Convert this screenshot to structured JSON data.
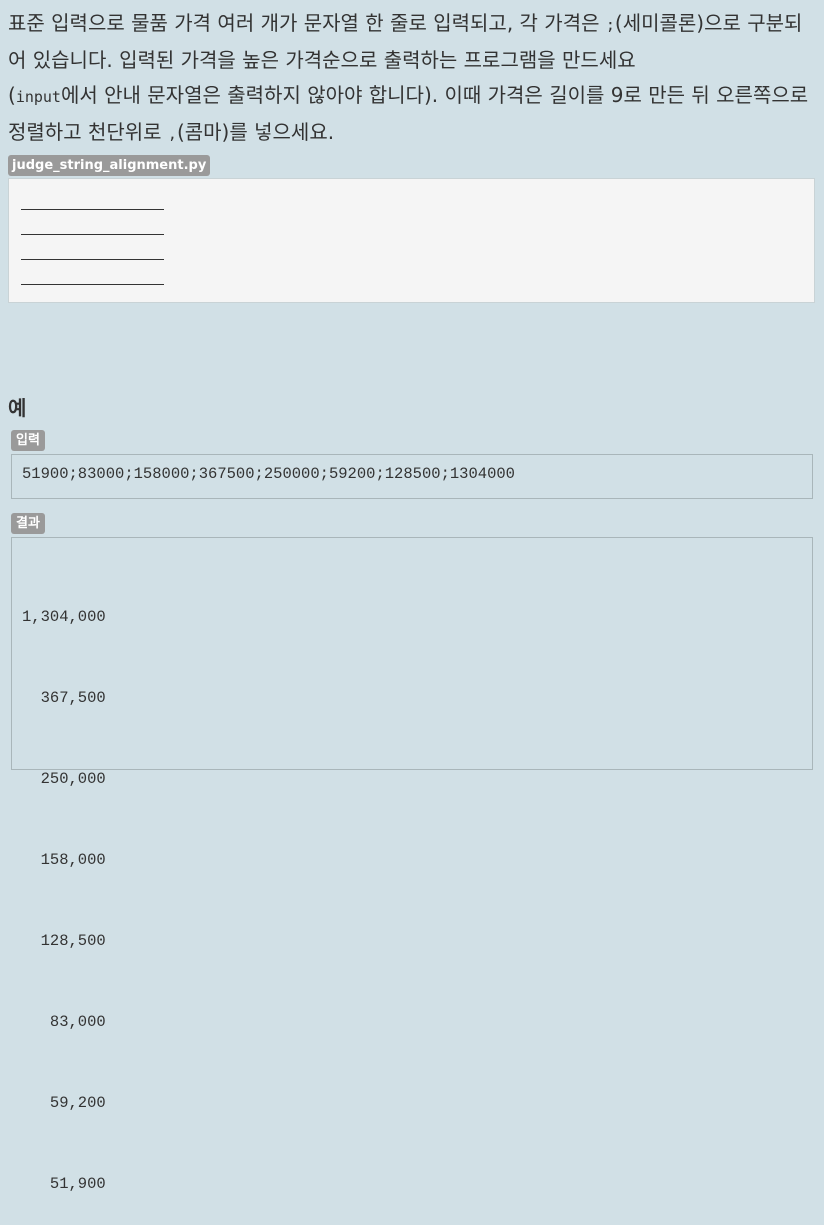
{
  "problem": {
    "p1": "표준 입력으로 물품 가격 여러 개가 문자열 한 줄로 입력되고, 각 가격은 ",
    "semicolon": ";",
    "p2": "(세미콜론)으로 구분되어 있습니다. 입력된 가격을 높은 가격순으로 출력하는 프로그램을 만드세요",
    "p3": "(",
    "input_code": "input",
    "p4": "에서 안내 문자열은 출력하지 않아야 합니다). 이때 가격은 길이를 9로 만든 뒤 오른쪽으로 정렬하고 천단위로 ",
    "comma": ",",
    "p5": "(콤마)를 넣으세요."
  },
  "file_tag": "judge_string_alignment.py",
  "example": {
    "title": "예",
    "input_label": "입력",
    "input_value": "51900;83000;158000;367500;250000;59200;128500;1304000",
    "output_label": "결과",
    "output_lines": [
      "1,304,000",
      "  367,500",
      "  250,000",
      "  158,000",
      "  128,500",
      "   83,000",
      "   59,200",
      "   51,900"
    ]
  }
}
